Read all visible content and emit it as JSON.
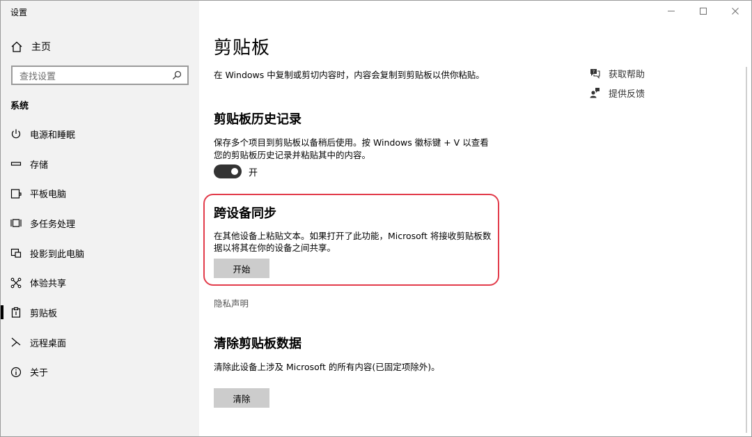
{
  "window": {
    "title": "设置",
    "controls": [
      "minimize",
      "maximize",
      "close"
    ]
  },
  "sidebar": {
    "home": {
      "label": "主页",
      "icon": "home-icon"
    },
    "search": {
      "placeholder": "查找设置",
      "icon": "search-icon"
    },
    "section": "系统",
    "items": [
      {
        "label": "电源和睡眠",
        "icon": "power-icon"
      },
      {
        "label": "存储",
        "icon": "storage-icon"
      },
      {
        "label": "平板电脑",
        "icon": "tablet-icon"
      },
      {
        "label": "多任务处理",
        "icon": "multitasking-icon"
      },
      {
        "label": "投影到此电脑",
        "icon": "project-icon"
      },
      {
        "label": "体验共享",
        "icon": "shared-experiences-icon"
      },
      {
        "label": "剪贴板",
        "icon": "clipboard-icon",
        "active": true
      },
      {
        "label": "远程桌面",
        "icon": "remote-desktop-icon"
      },
      {
        "label": "关于",
        "icon": "info-icon"
      }
    ]
  },
  "main": {
    "title": "剪贴板",
    "intro": "在 Windows 中复制或剪切内容时，内容会复制到剪贴板以供你粘贴。",
    "history": {
      "heading": "剪贴板历史记录",
      "desc_line1": "保存多个项目到剪贴板以备稍后使用。按 Windows 徽标键 + V 以查看",
      "desc_line2": "您的剪贴板历史记录并粘贴其中的内容。",
      "toggle_state": "开",
      "toggle_on": true
    },
    "sync": {
      "heading": "跨设备同步",
      "desc_line1": "在其他设备上粘贴文本。如果打开了此功能，Microsoft 将接收剪贴板数",
      "desc_line2": "据以将其在你的设备之间共享。",
      "button": "开始"
    },
    "privacy_link": "隐私声明",
    "clear": {
      "heading": "清除剪贴板数据",
      "desc": "清除此设备上涉及 Microsoft 的所有内容(已固定项除外)。",
      "button": "清除"
    }
  },
  "help": {
    "items": [
      {
        "label": "获取帮助",
        "icon": "help-chat-icon"
      },
      {
        "label": "提供反馈",
        "icon": "feedback-icon"
      }
    ]
  },
  "colors": {
    "highlight": "#e23b4a",
    "sidebar_bg": "#f2f2f2",
    "button_bg": "#cccccc"
  }
}
